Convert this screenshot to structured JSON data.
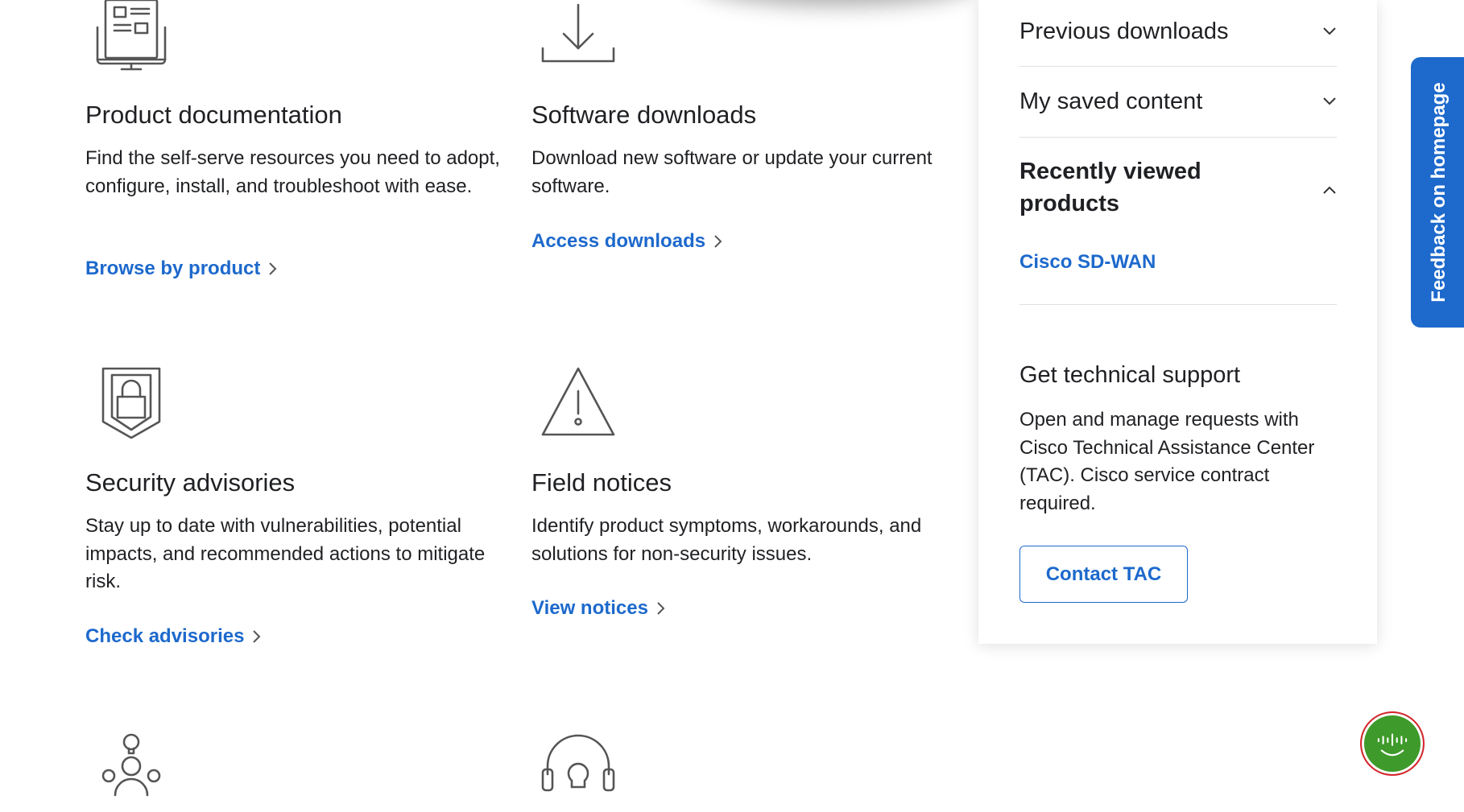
{
  "cards": [
    {
      "icon": "documentation-icon",
      "title": "Product documentation",
      "description": "Find the self-serve resources you need to adopt, configure, install, and troubleshoot with ease.",
      "link": "Browse by product"
    },
    {
      "icon": "download-icon",
      "title": "Software downloads",
      "description": "Download new software or update your current software.",
      "link": "Access downloads"
    },
    {
      "icon": "shield-lock-icon",
      "title": "Security advisories",
      "description": "Stay up to date with vulnerabilities, potential impacts, and recommended actions to mitigate risk.",
      "link": "Check advisories"
    },
    {
      "icon": "warning-icon",
      "title": "Field notices",
      "description": "Identify product symptoms, workarounds, and solutions for non-security issues.",
      "link": "View notices"
    },
    {
      "icon": "community-icon"
    },
    {
      "icon": "headset-icon"
    }
  ],
  "sidebar": {
    "accordion": [
      {
        "title": "Previous downloads",
        "expanded": false
      },
      {
        "title": "My saved content",
        "expanded": false
      },
      {
        "title": "Recently viewed products",
        "expanded": true,
        "items": [
          "Cisco SD-WAN"
        ]
      }
    ],
    "support": {
      "title": "Get technical support",
      "description": "Open and manage requests with Cisco Technical Assistance Center (TAC). Cisco service contract required.",
      "button": "Contact TAC"
    }
  },
  "feedback_tab": "Feedback on homepage",
  "chatbot": {
    "icon": "cisco-bot-icon"
  },
  "colors": {
    "link": "#1d69cc",
    "text": "#1f2023",
    "divider": "#dfdfdf",
    "feedback_bg": "#1d69cc",
    "chatbot_bg": "#3e9a2a"
  }
}
